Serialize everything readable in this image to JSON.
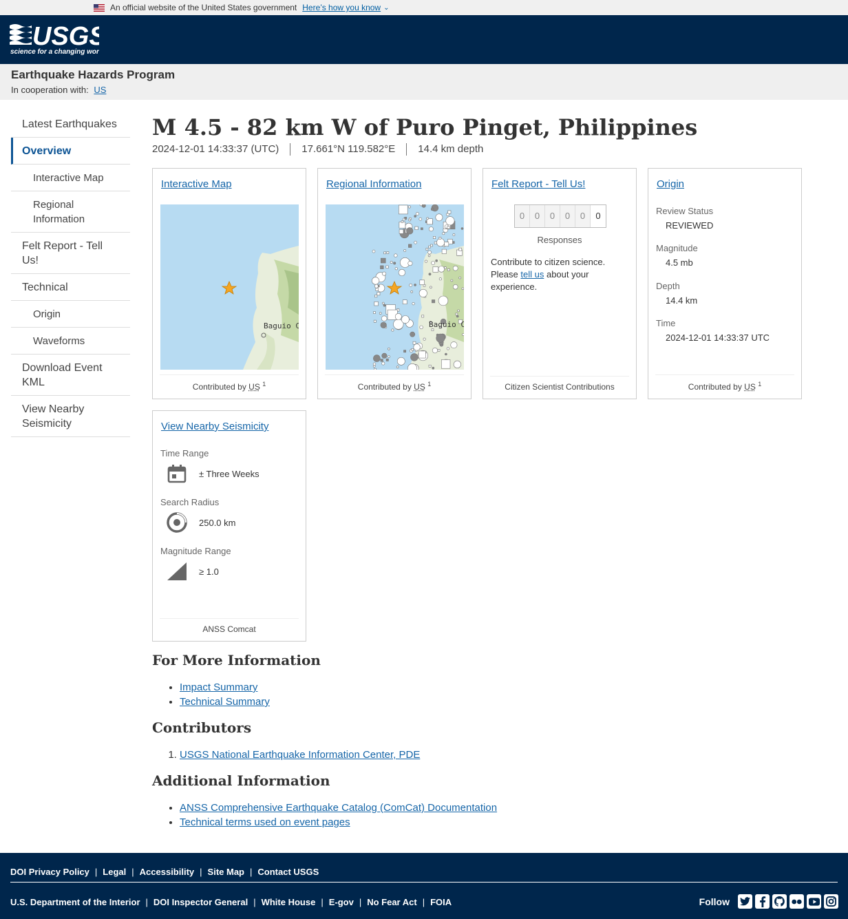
{
  "banner": {
    "text": "An official website of the United States government",
    "link": "Here’s how you know"
  },
  "header": {
    "logo_text": "USGS",
    "logo_tagline": "science for a changing world"
  },
  "site": {
    "title": "Earthquake Hazards Program",
    "coop_label": "In cooperation with:",
    "coop_link": "US"
  },
  "sidebar": {
    "items": [
      {
        "label": "Latest Earthquakes"
      },
      {
        "label": "Overview"
      },
      {
        "label": "Interactive Map"
      },
      {
        "label": "Regional Information"
      },
      {
        "label": "Felt Report - Tell Us!"
      },
      {
        "label": "Technical"
      },
      {
        "label": "Origin"
      },
      {
        "label": "Waveforms"
      },
      {
        "label": "Download Event KML"
      },
      {
        "label": "View Nearby Seismicity"
      }
    ]
  },
  "event": {
    "title": "M 4.5 - 82 km W of Puro Pinget, Philippines",
    "time": "2024-12-01 14:33:37 (UTC)",
    "coords": "17.661°N 119.582°E",
    "depth": "14.4 km depth"
  },
  "cards": {
    "map": {
      "title": "Interactive Map",
      "city": "Baguio C",
      "footer_prefix": "Contributed by",
      "footer_us": "US",
      "footer_sup": "1"
    },
    "regional": {
      "title": "Regional Information",
      "city": "Baguio C",
      "footer_prefix": "Contributed by",
      "footer_us": "US",
      "footer_sup": "1"
    },
    "felt": {
      "title": "Felt Report - Tell Us!",
      "digits": [
        "0",
        "0",
        "0",
        "0",
        "0",
        "0"
      ],
      "responses": "Responses",
      "text_before": "Contribute to citizen science. Please",
      "link": "tell us",
      "text_after": "about your experience.",
      "footer": "Citizen Scientist Contributions"
    },
    "origin": {
      "title": "Origin",
      "review_label": "Review Status",
      "review_value": "REVIEWED",
      "mag_label": "Magnitude",
      "mag_value": "4.5 mb",
      "depth_label": "Depth",
      "depth_value": "14.4 km",
      "time_label": "Time",
      "time_value": "2024-12-01 14:33:37 UTC",
      "footer_prefix": "Contributed by",
      "footer_us": "US",
      "footer_sup": "1"
    },
    "seismicity": {
      "title": "View Nearby Seismicity",
      "time_label": "Time Range",
      "time_value": "± Three Weeks",
      "time_icon": "calendar-icon",
      "radius_label": "Search Radius",
      "radius_value": "250.0 km",
      "radius_icon": "radius-target-icon",
      "mag_label": "Magnitude Range",
      "mag_value": "≥ 1.0",
      "mag_icon": "magnitude-wedge-icon",
      "footer": "ANSS Comcat"
    }
  },
  "more_info": {
    "heading": "For More Information",
    "links": [
      "Impact Summary",
      "Technical Summary"
    ]
  },
  "contributors": {
    "heading": "Contributors",
    "links": [
      "USGS National Earthquake Information Center, PDE"
    ]
  },
  "additional": {
    "heading": "Additional Information",
    "links": [
      "ANSS Comprehensive Earthquake Catalog (ComCat) Documentation",
      "Technical terms used on event pages"
    ]
  },
  "footer": {
    "top_links": [
      "DOI Privacy Policy",
      "Legal",
      "Accessibility",
      "Site Map",
      "Contact USGS"
    ],
    "bottom_links": [
      "U.S. Department of the Interior",
      "DOI Inspector General",
      "White House",
      "E-gov",
      "No Fear Act",
      "FOIA"
    ],
    "follow": "Follow",
    "social_icons": [
      "twitter-icon",
      "facebook-icon",
      "github-icon",
      "flickr-icon",
      "youtube-icon",
      "instagram-icon"
    ]
  },
  "colors": {
    "header_bg": "#00264c",
    "link": "#1565a8",
    "active_nav": "#0b5394",
    "map_water": "#b7dbf2",
    "star": "#f5a623"
  }
}
